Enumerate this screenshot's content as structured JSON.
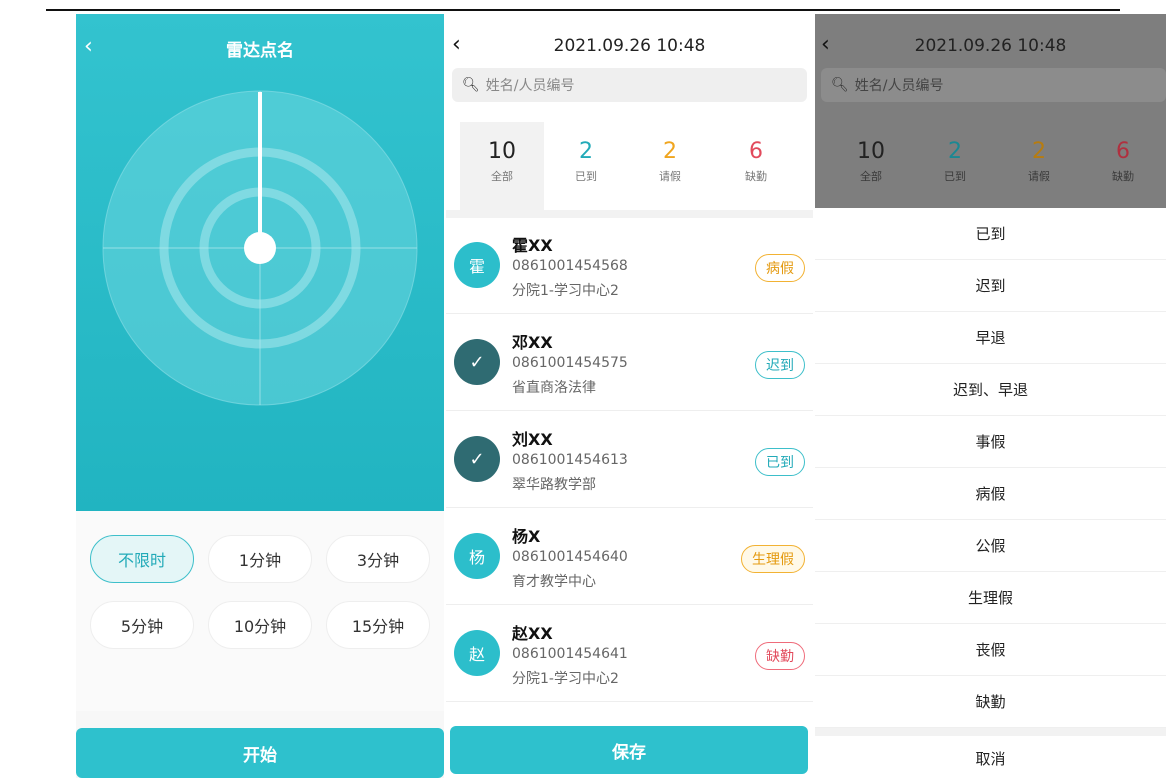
{
  "panel1": {
    "title": "雷达点名",
    "time_options": [
      "不限时",
      "1分钟",
      "3分钟",
      "5分钟",
      "10分钟",
      "15分钟"
    ],
    "selected_option": "不限时",
    "start_label": "开始"
  },
  "panel2": {
    "datetime": "2021.09.26 10:48",
    "search_placeholder": "姓名/人员编号",
    "stats": [
      {
        "count": "10",
        "label": "全部",
        "color": "#222222"
      },
      {
        "count": "2",
        "label": "已到",
        "color": "#22aab8"
      },
      {
        "count": "2",
        "label": "请假",
        "color": "#f0a51e"
      },
      {
        "count": "6",
        "label": "缺勤",
        "color": "#e24a5c"
      }
    ],
    "people": [
      {
        "avatar": "霍",
        "name": "霍XX",
        "id": "0861001454568",
        "org": "分院1-学习中心2",
        "status": "病假"
      },
      {
        "avatar": "✓",
        "name": "邓XX",
        "id": "0861001454575",
        "org": "省直商洛法律",
        "status": "迟到"
      },
      {
        "avatar": "✓",
        "name": "刘XX",
        "id": "0861001454613",
        "org": "翠华路教学部",
        "status": "已到"
      },
      {
        "avatar": "杨",
        "name": "杨X",
        "id": "0861001454640",
        "org": "育才教学中心",
        "status": "生理假"
      },
      {
        "avatar": "赵",
        "name": "赵XX",
        "id": "0861001454641",
        "org": "分院1-学习中心2",
        "status": "缺勤"
      }
    ],
    "save_label": "保存"
  },
  "panel3": {
    "datetime": "2021.09.26 10:48",
    "search_placeholder": "姓名/人员编号",
    "stats": [
      {
        "count": "10",
        "label": "全部"
      },
      {
        "count": "2",
        "label": "已到"
      },
      {
        "count": "2",
        "label": "请假"
      },
      {
        "count": "6",
        "label": "缺勤"
      }
    ],
    "options": [
      "已到",
      "迟到",
      "早退",
      "迟到、早退",
      "事假",
      "病假",
      "公假",
      "生理假",
      "丧假",
      "缺勤"
    ],
    "cancel_label": "取消"
  }
}
